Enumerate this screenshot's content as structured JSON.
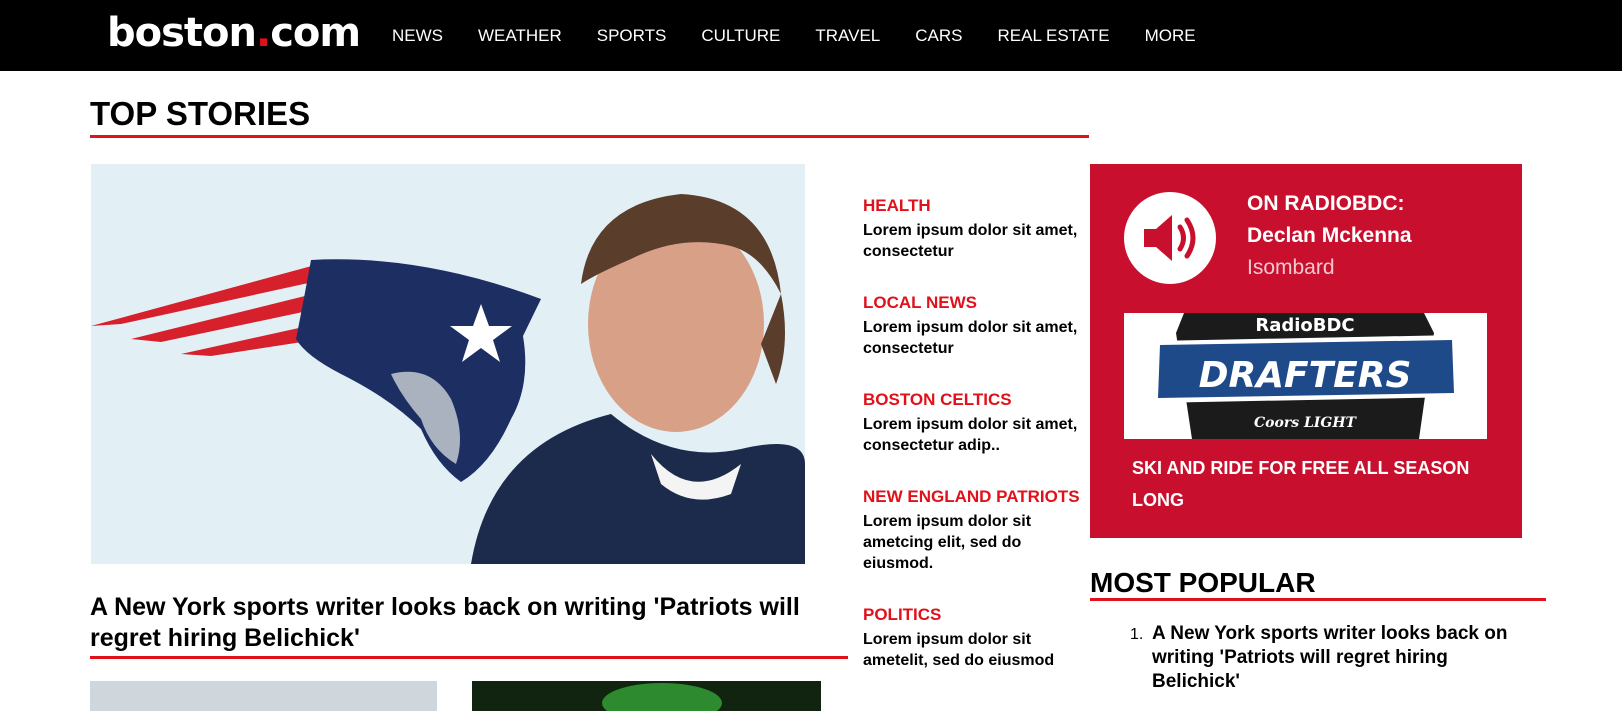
{
  "header": {
    "logo_main": "boston",
    "logo_dot": ".",
    "logo_tld": "com",
    "nav": [
      "NEWS",
      "WEATHER",
      "SPORTS",
      "CULTURE",
      "TRAVEL",
      "CARS",
      "REAL ESTATE",
      "MORE"
    ]
  },
  "top_stories": {
    "title": "TOP STORIES",
    "hero_headline": "A New York sports writer looks back on writing 'Patriots will regret hiring Belichick'"
  },
  "side_stories": [
    {
      "category": "HEALTH",
      "text": "Lorem ipsum dolor sit amet, consectetur"
    },
    {
      "category": "LOCAL NEWS",
      "text": "Lorem ipsum dolor sit amet, consectetur"
    },
    {
      "category": "BOSTON CELTICS",
      "text": "Lorem ipsum dolor sit amet, consectetur adip.."
    },
    {
      "category": "NEW ENGLAND PATRIOTS",
      "text": "Lorem ipsum dolor sit ametcing elit, sed do eiusmod."
    },
    {
      "category": "POLITICS",
      "text": "Lorem ipsum dolor sit ametelit, sed do eiusmod"
    }
  ],
  "ad": {
    "line1": "ON RADIOBDC:",
    "line2": "Declan Mckenna",
    "line3": "Isombard",
    "banner_top": "RadioBDC",
    "banner_main": "DRAFTERS",
    "banner_sponsor": "Coors LIGHT",
    "cta": "SKI AND RIDE FOR FREE ALL SEASON LONG",
    "bg_color": "#c8102e"
  },
  "most_popular": {
    "title": "MOST POPULAR",
    "items": [
      {
        "num": "1.",
        "text": "A New York sports writer looks back on writing 'Patriots will regret hiring Belichick'"
      }
    ]
  },
  "colors": {
    "accent": "#e0111a",
    "nav_bg": "#000000"
  }
}
